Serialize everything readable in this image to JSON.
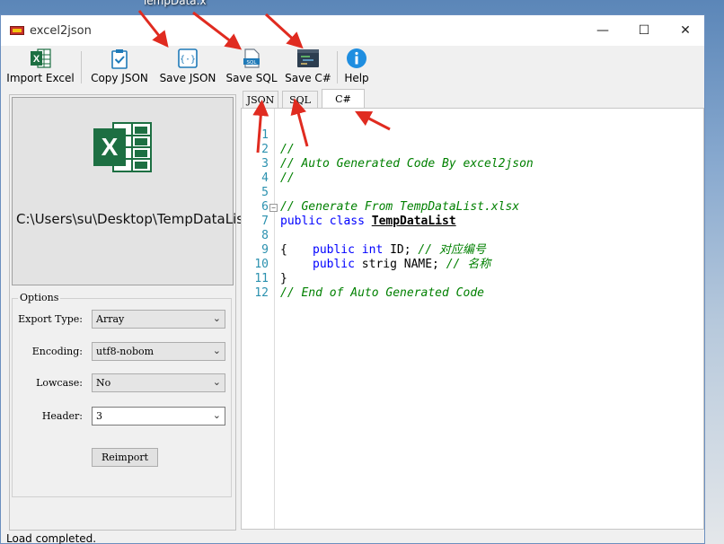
{
  "desktop_label": "TempData.x",
  "window": {
    "title": "excel2json",
    "controls": {
      "minimize": "—",
      "maximize": "☐",
      "close": "✕"
    }
  },
  "toolbar": {
    "import_excel": "Import Excel",
    "copy_json": "Copy JSON",
    "save_json": "Save JSON",
    "save_sql": "Save SQL",
    "save_csharp": "Save C#",
    "help": "Help",
    "sql_icon_text": "SQL"
  },
  "left_panel": {
    "file_path": "C:\\Users\\su\\Desktop\\TempDataList.xlsx",
    "options": {
      "legend": "Options",
      "export_type_label": "Export Type:",
      "export_type_value": "Array",
      "encoding_label": "Encoding:",
      "encoding_value": "utf8-nobom",
      "lowcase_label": "Lowcase:",
      "lowcase_value": "No",
      "header_label": "Header:",
      "header_value": "3",
      "reimport_label": "Reimport"
    }
  },
  "tabs": [
    "JSON",
    "SQL",
    "C#"
  ],
  "active_tab": "C#",
  "code": {
    "line_numbers": [
      "1",
      "2",
      "3",
      "4",
      "5",
      "6",
      "7",
      "8",
      "9",
      "10",
      "11",
      "12"
    ],
    "lines": {
      "l1": "//",
      "l2": "// Auto Generated Code By excel2json",
      "l3": "//",
      "l5": "// Generate From TempDataList.xlsx",
      "l6_kw": "public class ",
      "l6_cls": "TempDataList",
      "l7": "{",
      "l8_kw": "public int",
      "l8_rest": " ID; ",
      "l8_cmt": "// 对应编号",
      "l9_kw": "public",
      "l9_rest": " strig NAME; ",
      "l9_cmt": "// 名称",
      "l10": "}",
      "l11": "// End of Auto Generated Code"
    }
  },
  "status": "Load completed.",
  "colors": {
    "excel_green": "#1d6f42",
    "annotation_red": "#e02b20",
    "comment": "#008000",
    "keyword": "#0000ff",
    "line_number": "#2b91af"
  }
}
